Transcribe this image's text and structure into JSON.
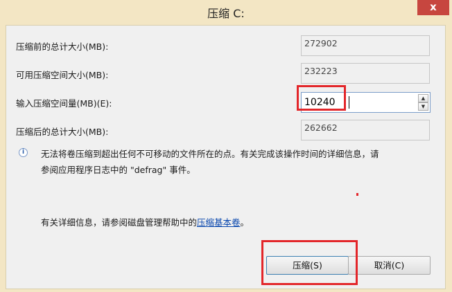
{
  "window": {
    "title": "压缩 C:",
    "close_glyph": "x"
  },
  "fields": {
    "total_before": {
      "label": "压缩前的总计大小(MB):",
      "value": "272902"
    },
    "available": {
      "label": "可用压缩空间大小(MB):",
      "value": "232223"
    },
    "shrink_amount": {
      "label": "输入压缩空间量(MB)(E):",
      "value": "10240"
    },
    "total_after": {
      "label": "压缩后的总计大小(MB):",
      "value": "262662"
    }
  },
  "spinner": {
    "up_glyph": "▲",
    "down_glyph": "▼"
  },
  "info": {
    "icon_glyph": "i",
    "line1": "无法将卷压缩到超出任何不可移动的文件所在的点。有关完成该操作时间的详细信息，请",
    "line2": "参阅应用程序日志中的 \"defrag\" 事件。"
  },
  "help": {
    "prefix": "有关详细信息，请参阅磁盘管理帮助中的",
    "link": "压缩基本卷",
    "suffix": "。"
  },
  "buttons": {
    "shrink": "压缩(S)",
    "cancel": "取消(C)"
  },
  "colors": {
    "annotation_red": "#e3262a",
    "title_bar": "#f3e6c4",
    "close_button": "#c7463f",
    "link_blue": "#0645ad"
  }
}
